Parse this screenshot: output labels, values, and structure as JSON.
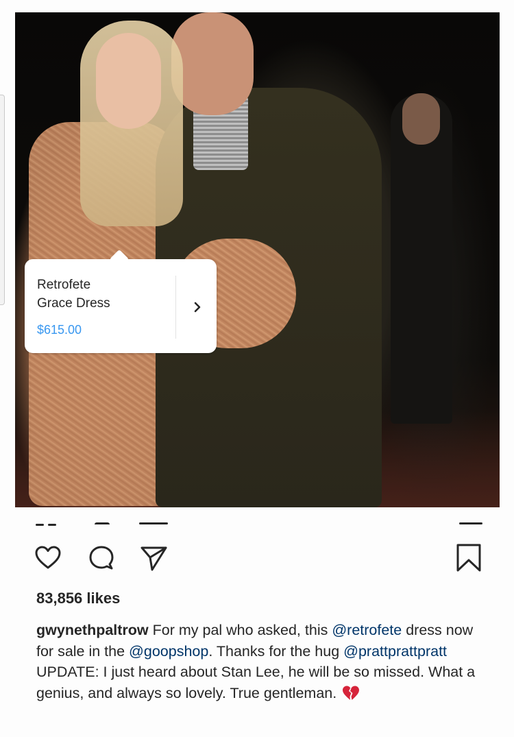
{
  "product_tag": {
    "name_line1": "Retrofete",
    "name_line2": "Grace Dress",
    "price": "$615.00",
    "chevron": "›"
  },
  "actions": {
    "like_icon": "heart-outline-icon",
    "comment_icon": "comment-bubble-icon",
    "share_icon": "paper-plane-icon",
    "save_icon": "bookmark-icon"
  },
  "likes": "83,856 likes",
  "caption": {
    "username": "gwynethpaltrow",
    "text_1": " For my pal who asked, this ",
    "mention_1": "@retrofete",
    "text_2": " dress now for sale in the ",
    "mention_2": "@goopshop",
    "text_3": ". Thanks for the hug ",
    "mention_3": "@prattprattpratt",
    "text_4": " UPDATE: I just heard about Stan Lee, he will be so missed. What a genius, and always so lovely. True gentleman.",
    "emoji": "broken-heart-icon"
  },
  "colors": {
    "accent": "#3897f0",
    "mention": "#003569",
    "text": "#262626",
    "heart": "#d6243a"
  }
}
